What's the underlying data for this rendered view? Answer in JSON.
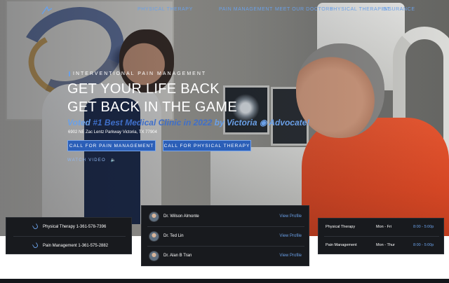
{
  "nav": {
    "logo_icon": "clinic-logo-icon",
    "items": [
      "Physical Therapy",
      "Pain Management",
      "Meet Our Doctors",
      "Physical Therapist",
      "Insurance"
    ]
  },
  "hero": {
    "kicker": "Interventional Pain Management",
    "headline_line1": "GET YOUR LIFE BACK",
    "headline_line2": "GET BACK IN THE GAME",
    "voted_prefix": "Voted",
    "voted_highlight": "#1 Best Medical Clinic in 2022",
    "voted_by": "by Victoria",
    "voted_suffix": "Advocate!",
    "address": "6902 NE Zac Lentz Parkway Victoria, TX 77904",
    "cta_pain": "Call for Pain Management",
    "cta_therapy": "Call for Physical Therapy",
    "watch_video": "Watch Video",
    "volume_icon": "volume-icon"
  },
  "phones": [
    {
      "text": "Physical Therapy 1-361-578-7396",
      "icon": "phone-icon"
    },
    {
      "text": "Pain Management 1-361-575-2882",
      "icon": "phone-icon"
    }
  ],
  "doctors": [
    {
      "name": "Dr. Wilson Almonte",
      "link": "View Profile"
    },
    {
      "name": "Dr. Ted Lin",
      "link": "View Profile"
    },
    {
      "name": "Dr. Alan B Tran",
      "link": "View Profile"
    }
  ],
  "hours": [
    {
      "dept": "Physical Therapy",
      "days": "Mon - Fri",
      "time": "8:00 - 5:00p"
    },
    {
      "dept": "Pain Management",
      "days": "Mon - Thur",
      "time": "8:00 - 5:00p"
    }
  ],
  "colors": {
    "accent": "#6aa0e8",
    "button": "#2b5fb8",
    "panel": "#181a1e",
    "shirt": "#e04a25"
  }
}
